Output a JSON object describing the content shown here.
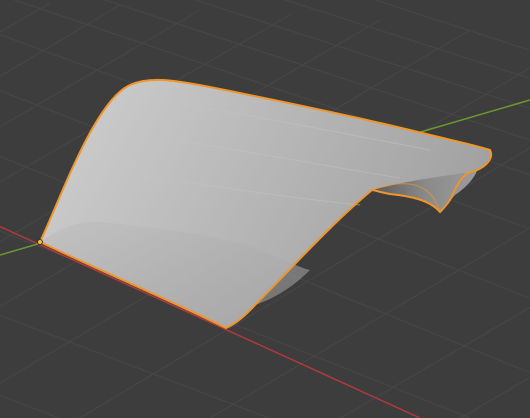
{
  "viewport": {
    "background_color": "#3d3d3d",
    "grid_color": "#4a4a4a",
    "x_axis_color": "#b1393d",
    "y_axis_color": "#6b9a2c",
    "selection_outline_color": "#f0952a",
    "origin_dot_color": "#f5b43a",
    "mesh_light_color": "#b8b8b8",
    "mesh_shadow_color": "#6c6c6c"
  },
  "object": {
    "name_icon": "curved-surface-mesh",
    "selected": true
  }
}
